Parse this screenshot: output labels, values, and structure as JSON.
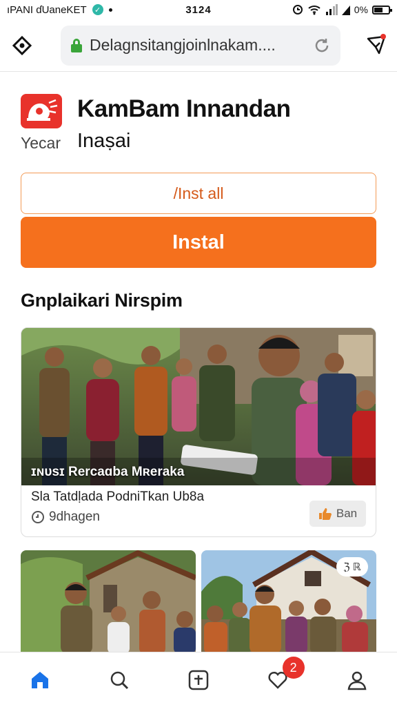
{
  "status_bar": {
    "carrier": "ıPANI ɗUaneKET",
    "time": "3124",
    "battery": "0%"
  },
  "browser": {
    "url": "Delagnsitangjoinlnakam....",
    "icons": [
      "diamond-nav-icon",
      "lock-icon",
      "reload-icon",
      "share-icon"
    ]
  },
  "app": {
    "title": "KamBam Innandan",
    "sub_label": "Yecar",
    "sub_value": "Inaṣai",
    "logo_color": "#e8322b"
  },
  "buttons": {
    "install_outline": "/Inst all",
    "install_primary": "Instal",
    "accent_color": "#f5701d"
  },
  "section": {
    "title": "Gnplaikari Nirspim"
  },
  "feature_card": {
    "overlay": "ɪɴᴜsɪ Rercaɑba Mʀeraka",
    "caption": "Sla Tatdḷada PodniTkan Ub8a",
    "meta": "9dhagen",
    "action": "Ban"
  },
  "thumbnails": [
    {
      "badge": ""
    },
    {
      "badge": "ℨ ℝ"
    }
  ],
  "bottom_nav": {
    "items": [
      "home-icon",
      "search-icon",
      "add-icon",
      "heart-icon",
      "profile-icon"
    ],
    "notification_count": "2",
    "active_color": "#1a73e8"
  }
}
